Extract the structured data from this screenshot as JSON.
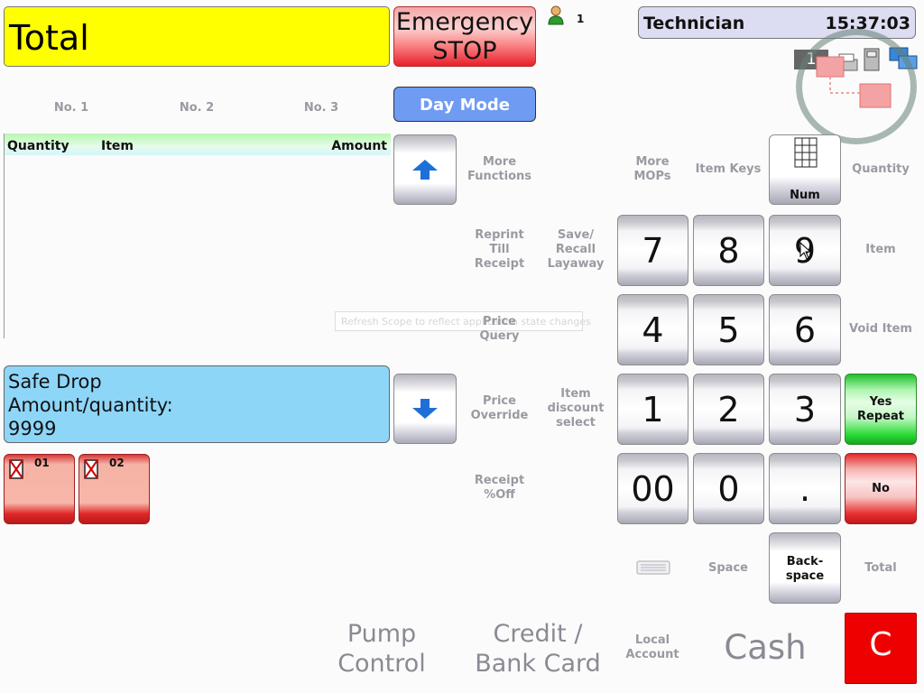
{
  "total_display": {
    "label": "Total"
  },
  "emergency_stop": {
    "label": "Emergency\nSTOP"
  },
  "user": {
    "count": "1"
  },
  "header": {
    "role": "Technician",
    "time": "15:37:03"
  },
  "status": {
    "monitor_number": "1"
  },
  "day_mode": {
    "label": "Day Mode"
  },
  "tills": [
    "No. 1",
    "No. 2",
    "No. 3"
  ],
  "transaction_list": {
    "columns": {
      "quantity": "Quantity",
      "item": "Item",
      "amount": "Amount"
    }
  },
  "tooltip": "Refresh Scope to reflect application state changes",
  "message": {
    "line1": "Safe Drop",
    "line2": "Amount/quantity:",
    "line3": "9999"
  },
  "pumps": [
    {
      "number": "01"
    },
    {
      "number": "02"
    }
  ],
  "functions": {
    "more_functions": "More\nFunctions",
    "more_mops": "More\nMOPs",
    "item_keys": "Item Keys",
    "quantity": "Quantity",
    "reprint": "Reprint\nTill\nReceipt",
    "save_recall": "Save/\nRecall\nLayaway",
    "item": "Item",
    "price_query": "Price\nQuery",
    "void_item": "Void Item",
    "price_override": "Price\nOverride",
    "item_discount": "Item\ndiscount\nselect",
    "receipt_off": "Receipt\n%Off",
    "space": "Space",
    "total": "Total",
    "local_account": "Local\nAccount"
  },
  "keypad": {
    "num": "Num",
    "k7": "7",
    "k8": "8",
    "k9": "9",
    "k4": "4",
    "k5": "5",
    "k6": "6",
    "k1": "1",
    "k2": "2",
    "k3": "3",
    "k00": "00",
    "k0": "0",
    "kdot": ".",
    "backspace": "Back-\nspace",
    "yes_repeat": "Yes\nRepeat",
    "no": "No"
  },
  "payments": {
    "pump_control": "Pump\nControl",
    "credit_card": "Credit /\nBank Card",
    "cash": "Cash",
    "clear": "C"
  },
  "colors": {
    "total_bg": "#ffff00",
    "stop_red": "#e8202a",
    "day_mode_blue": "#6f9bf2",
    "message_bg": "#8ed6f8",
    "yes_green": "#2ddc38",
    "clear_red": "#ee0000"
  }
}
